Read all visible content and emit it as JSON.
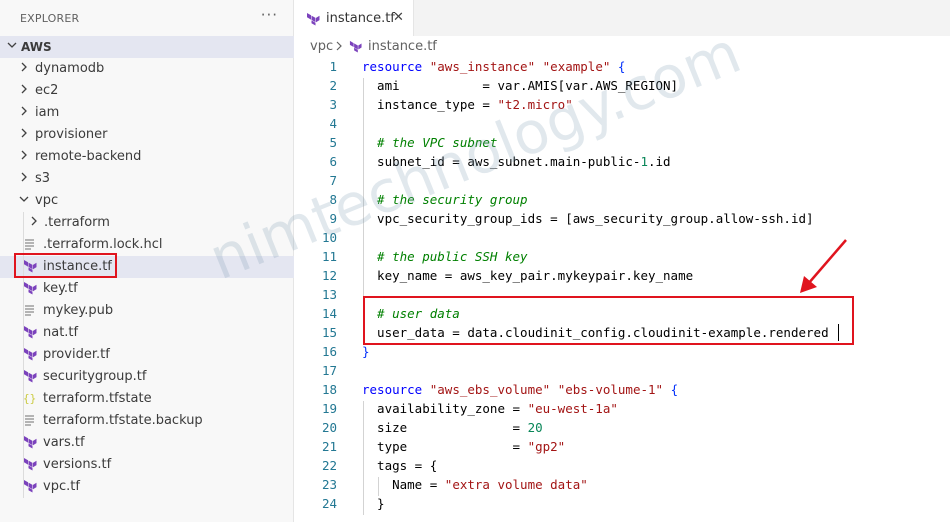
{
  "explorer": {
    "title": "EXPLORER",
    "more_icon": "ellipsis-icon",
    "root": "AWS",
    "items": [
      {
        "label": "dynamodb",
        "type": "folder",
        "depth": 0,
        "expanded": false
      },
      {
        "label": "ec2",
        "type": "folder",
        "depth": 0,
        "expanded": false
      },
      {
        "label": "iam",
        "type": "folder",
        "depth": 0,
        "expanded": false
      },
      {
        "label": "provisioner",
        "type": "folder",
        "depth": 0,
        "expanded": false
      },
      {
        "label": "remote-backend",
        "type": "folder",
        "depth": 0,
        "expanded": false
      },
      {
        "label": "s3",
        "type": "folder",
        "depth": 0,
        "expanded": false
      },
      {
        "label": "vpc",
        "type": "folder",
        "depth": 0,
        "expanded": true
      },
      {
        "label": ".terraform",
        "type": "folder",
        "depth": 1,
        "expanded": false
      },
      {
        "label": ".terraform.lock.hcl",
        "type": "lines",
        "depth": 1
      },
      {
        "label": "instance.tf",
        "type": "terraform",
        "depth": 1,
        "selected": true
      },
      {
        "label": "key.tf",
        "type": "terraform",
        "depth": 1
      },
      {
        "label": "mykey.pub",
        "type": "lines",
        "depth": 1
      },
      {
        "label": "nat.tf",
        "type": "terraform",
        "depth": 1
      },
      {
        "label": "provider.tf",
        "type": "terraform",
        "depth": 1
      },
      {
        "label": "securitygroup.tf",
        "type": "terraform",
        "depth": 1
      },
      {
        "label": "terraform.tfstate",
        "type": "json",
        "depth": 1
      },
      {
        "label": "terraform.tfstate.backup",
        "type": "lines",
        "depth": 1
      },
      {
        "label": "vars.tf",
        "type": "terraform",
        "depth": 1
      },
      {
        "label": "versions.tf",
        "type": "terraform",
        "depth": 1
      },
      {
        "label": "vpc.tf",
        "type": "terraform",
        "depth": 1
      }
    ]
  },
  "editor": {
    "tab": {
      "label": "instance.tf",
      "icon": "terraform-icon",
      "close_icon": "close-icon"
    },
    "breadcrumb": [
      "vpc",
      "instance.tf"
    ],
    "lines": [
      {
        "n": "1",
        "tokens": [
          [
            "kw",
            "resource"
          ],
          [
            "t",
            " "
          ],
          [
            "st",
            "\"aws_instance\""
          ],
          [
            "t",
            " "
          ],
          [
            "st",
            "\"example\""
          ],
          [
            "t",
            " "
          ],
          [
            "br",
            "{"
          ]
        ]
      },
      {
        "n": "2",
        "tokens": [
          [
            "t",
            "  ami           = var.AMIS[var.AWS_REGION]"
          ]
        ]
      },
      {
        "n": "3",
        "tokens": [
          [
            "t",
            "  instance_type = "
          ],
          [
            "st",
            "\"t2.micro\""
          ]
        ]
      },
      {
        "n": "4",
        "tokens": [
          [
            "t",
            ""
          ]
        ]
      },
      {
        "n": "5",
        "tokens": [
          [
            "cm",
            "  # the VPC subnet"
          ]
        ]
      },
      {
        "n": "6",
        "tokens": [
          [
            "t",
            "  subnet_id = aws_subnet.main-public-"
          ],
          [
            "nm",
            "1"
          ],
          [
            "t",
            ".id"
          ]
        ]
      },
      {
        "n": "7",
        "tokens": [
          [
            "t",
            ""
          ]
        ]
      },
      {
        "n": "8",
        "tokens": [
          [
            "cm",
            "  # the security group"
          ]
        ]
      },
      {
        "n": "9",
        "tokens": [
          [
            "t",
            "  vpc_security_group_ids = [aws_security_group.allow-ssh.id]"
          ]
        ]
      },
      {
        "n": "10",
        "tokens": [
          [
            "t",
            ""
          ]
        ]
      },
      {
        "n": "11",
        "tokens": [
          [
            "cm",
            "  # the public SSH key"
          ]
        ]
      },
      {
        "n": "12",
        "tokens": [
          [
            "t",
            "  key_name = aws_key_pair.mykeypair.key_name"
          ]
        ]
      },
      {
        "n": "13",
        "tokens": [
          [
            "t",
            ""
          ]
        ]
      },
      {
        "n": "14",
        "tokens": [
          [
            "cm",
            "  # user data"
          ]
        ]
      },
      {
        "n": "15",
        "tokens": [
          [
            "t",
            "  user_data = data.cloudinit_config.cloudinit-example.rendered"
          ]
        ]
      },
      {
        "n": "16",
        "tokens": [
          [
            "br",
            "}"
          ]
        ]
      },
      {
        "n": "17",
        "tokens": [
          [
            "t",
            ""
          ]
        ]
      },
      {
        "n": "18",
        "tokens": [
          [
            "kw",
            "resource"
          ],
          [
            "t",
            " "
          ],
          [
            "st",
            "\"aws_ebs_volume\""
          ],
          [
            "t",
            " "
          ],
          [
            "st",
            "\"ebs-volume-1\""
          ],
          [
            "t",
            " "
          ],
          [
            "br",
            "{"
          ]
        ]
      },
      {
        "n": "19",
        "tokens": [
          [
            "t",
            "  availability_zone = "
          ],
          [
            "st",
            "\"eu-west-1a\""
          ]
        ]
      },
      {
        "n": "20",
        "tokens": [
          [
            "t",
            "  size              = "
          ],
          [
            "nm",
            "20"
          ]
        ]
      },
      {
        "n": "21",
        "tokens": [
          [
            "t",
            "  type              = "
          ],
          [
            "st",
            "\"gp2\""
          ]
        ]
      },
      {
        "n": "22",
        "tokens": [
          [
            "t",
            "  tags = {"
          ]
        ]
      },
      {
        "n": "23",
        "tokens": [
          [
            "t",
            "    Name = "
          ],
          [
            "st",
            "\"extra volume data\""
          ]
        ]
      },
      {
        "n": "24",
        "tokens": [
          [
            "t",
            "  }"
          ]
        ]
      }
    ]
  },
  "watermark": "nimtechnology.com",
  "colors": {
    "highlight": "#e0141e",
    "terraform_icon": "#7b42bc",
    "json_icon": "#cbcb41"
  }
}
